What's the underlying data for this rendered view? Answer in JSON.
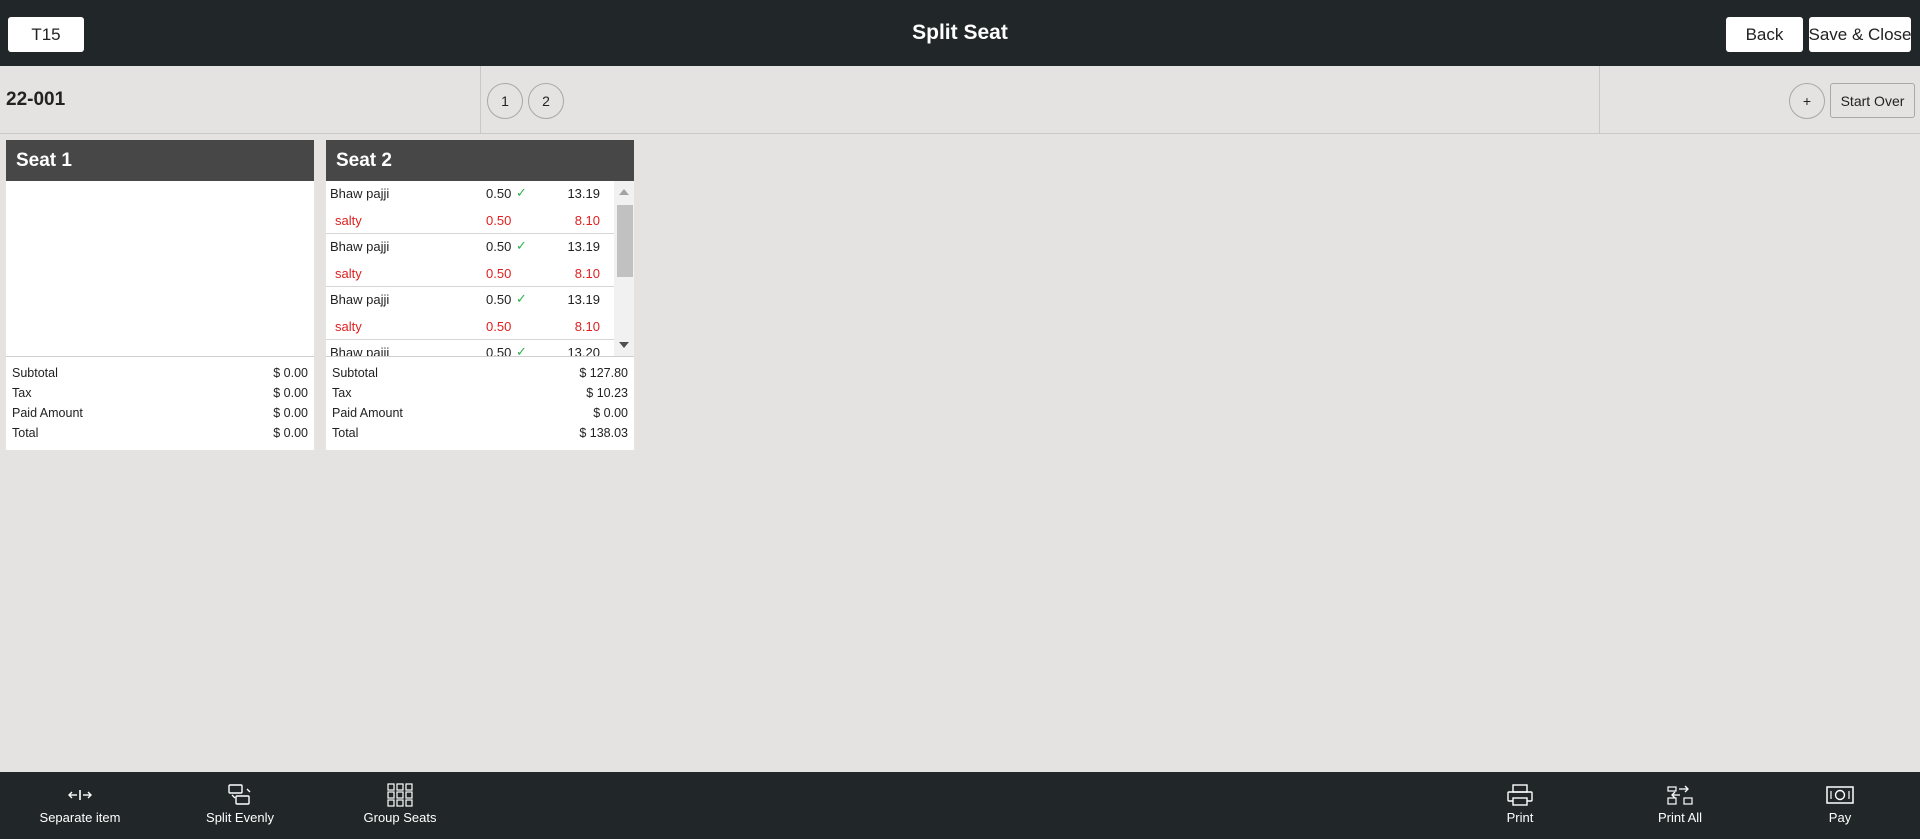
{
  "header": {
    "table_label": "T15",
    "title": "Split Seat",
    "back_label": "Back",
    "save_close_label": "Save & Close"
  },
  "subbar": {
    "order_number": "22-001",
    "seat_tabs": [
      "1",
      "2"
    ],
    "add_seat_label": "+",
    "start_over_label": "Start Over"
  },
  "seats": [
    {
      "title": "Seat 1",
      "items": [],
      "totals": {
        "subtotal_label": "Subtotal",
        "subtotal": "$ 0.00",
        "tax_label": "Tax",
        "tax": "$ 0.00",
        "paid_label": "Paid Amount",
        "paid": "$ 0.00",
        "total_label": "Total",
        "total": "$ 0.00"
      }
    },
    {
      "title": "Seat 2",
      "items": [
        {
          "name": "Bhaw pajji",
          "qty": "0.50",
          "check": "✓",
          "price": "13.19",
          "mod_name": "salty",
          "mod_qty": "0.50",
          "mod_price": "8.10"
        },
        {
          "name": "Bhaw pajji",
          "qty": "0.50",
          "check": "✓",
          "price": "13.19",
          "mod_name": "salty",
          "mod_qty": "0.50",
          "mod_price": "8.10"
        },
        {
          "name": "Bhaw pajji",
          "qty": "0.50",
          "check": "✓",
          "price": "13.19",
          "mod_name": "salty",
          "mod_qty": "0.50",
          "mod_price": "8.10"
        },
        {
          "name": "Bhaw pajji",
          "qty": "0.50",
          "check": "✓",
          "price": "13.20",
          "mod_name": "",
          "mod_qty": "",
          "mod_price": ""
        }
      ],
      "totals": {
        "subtotal_label": "Subtotal",
        "subtotal": "$ 127.80",
        "tax_label": "Tax",
        "tax": "$ 10.23",
        "paid_label": "Paid Amount",
        "paid": "$ 0.00",
        "total_label": "Total",
        "total": "$ 138.03"
      }
    }
  ],
  "toolbar": {
    "separate_item": "Separate item",
    "split_evenly": "Split Evenly",
    "group_seats": "Group Seats",
    "print": "Print",
    "print_all": "Print All",
    "pay": "Pay"
  },
  "colors": {
    "bar": "#212628",
    "seat_header": "#474747",
    "modifier": "#e02020",
    "check": "#2bb24c"
  }
}
